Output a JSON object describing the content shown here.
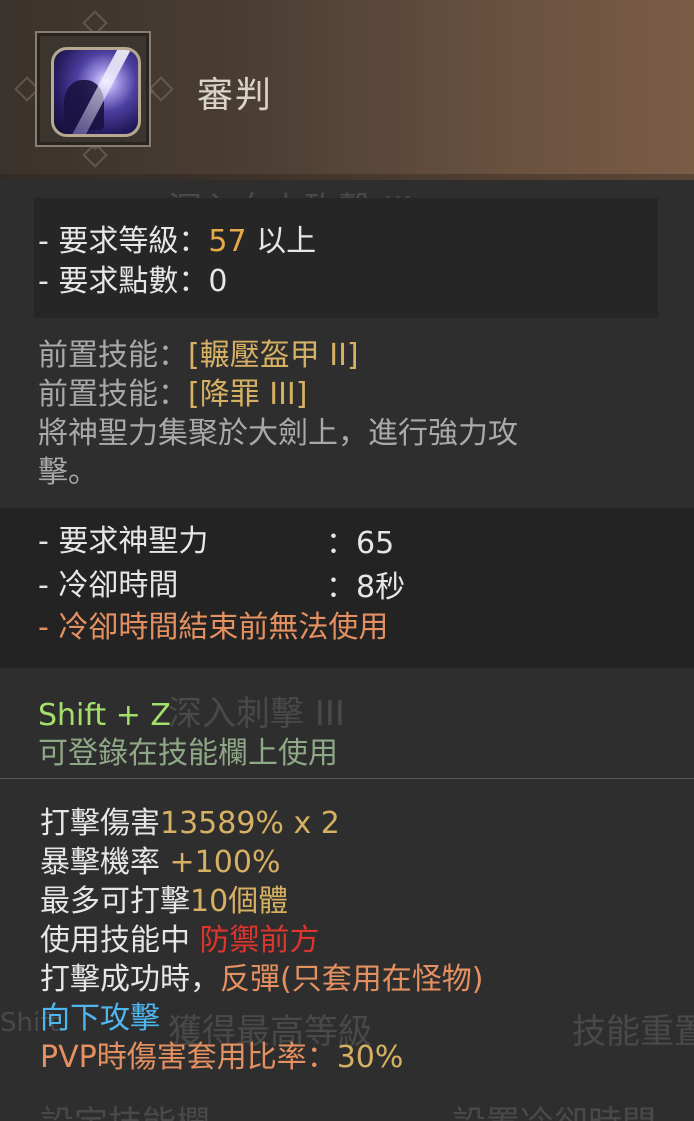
{
  "skill": {
    "name": "審判",
    "icon": "judgment-skill-icon"
  },
  "requirements": {
    "level_label": "- 要求等級：",
    "level_value": "57",
    "level_suffix": "以上",
    "points_label": "- 要求點數：",
    "points_value": "0"
  },
  "prerequisites": [
    {
      "label": "前置技能：",
      "skill": "[輾壓盔甲 II]"
    },
    {
      "label": "前置技能：",
      "skill": "[降罪 III]"
    }
  ],
  "description": [
    "將神聖力集聚於大劍上，進行強力攻",
    "擊。"
  ],
  "costs": {
    "holy_label": "- 要求神聖力",
    "holy_value": "：65",
    "cooldown_label": "- 冷卻時間",
    "cooldown_value": "：8秒",
    "cooldown_note": "- 冷卻時間結束前無法使用"
  },
  "hotkey": {
    "keys": "Shift + Z",
    "note": "可登錄在技能欄上使用"
  },
  "stats": {
    "damage_label": "打擊傷害",
    "damage_value": "13589% x 2",
    "crit_label": "暴擊機率 ",
    "crit_value": "+100%",
    "targets_label": "最多可打擊",
    "targets_value": "10個體",
    "guard_label": "使用技能中 ",
    "guard_value": "防禦前方",
    "onhit_label": "打擊成功時，",
    "onhit_value": "反彈(只套用在怪物)",
    "down_attack": "向下攻擊",
    "pvp_label": "PVP時傷害套用比率：",
    "pvp_value": "30%"
  },
  "background": {
    "ghost_1": "深入向上砍擊 III",
    "ghost_2": "深入刺擊 III",
    "ghost_3": "獲得最高等級",
    "ghost_4": "技能重置",
    "ghost_5": "Shift",
    "ghost_6": "設定技能欄",
    "ghost_7": "設置冷卻時間"
  },
  "colors": {
    "level_value": "#e8a94a",
    "prereq": "#d6b063",
    "warning": "#e59060",
    "hotkey": "#a3e06a",
    "guard": "#e0342c",
    "down_attack": "#4fb7f0"
  }
}
